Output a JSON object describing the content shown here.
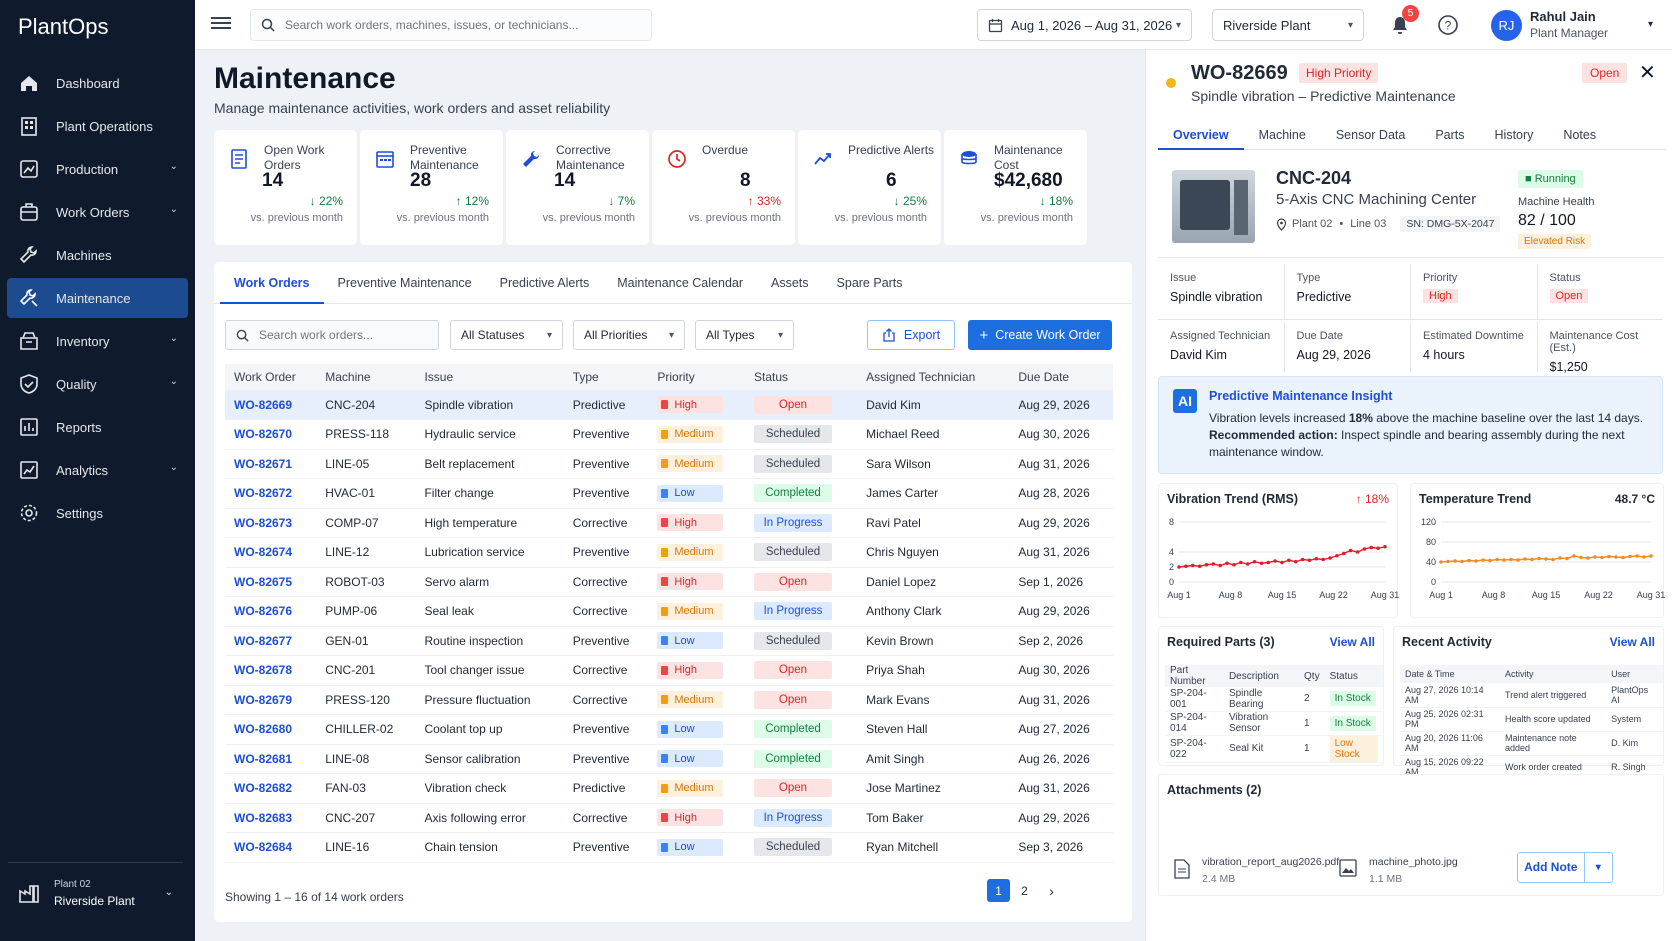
{
  "app": {
    "name": "PlantOps"
  },
  "sidebar": {
    "items": [
      {
        "label": "Dashboard",
        "icon": "home-icon",
        "chev": false
      },
      {
        "label": "Plant Operations",
        "icon": "building-icon",
        "chev": false
      },
      {
        "label": "Production",
        "icon": "production-icon",
        "chev": true
      },
      {
        "label": "Work Orders",
        "icon": "work-orders-icon",
        "chev": true
      },
      {
        "label": "Machines",
        "icon": "wrench-icon",
        "chev": false
      },
      {
        "label": "Maintenance",
        "icon": "maintenance-icon",
        "chev": false,
        "active": true
      },
      {
        "label": "Inventory",
        "icon": "inventory-icon",
        "chev": true
      },
      {
        "label": "Quality",
        "icon": "shield-icon",
        "chev": true
      },
      {
        "label": "Reports",
        "icon": "reports-icon",
        "chev": false
      },
      {
        "label": "Analytics",
        "icon": "analytics-icon",
        "chev": true
      },
      {
        "label": "Settings",
        "icon": "gear-icon",
        "chev": false
      }
    ],
    "footer": {
      "line1": "Plant 02",
      "line2": "Riverside Plant"
    }
  },
  "topbar": {
    "search_placeholder": "Search work orders, machines, issues, or technicians...",
    "date_range": "Aug 1, 2026 – Aug 31, 2026",
    "plant": "Riverside Plant",
    "notifications": "5",
    "user": {
      "initials": "RJ",
      "name": "Rahul Jain",
      "role": "Plant Manager"
    }
  },
  "page": {
    "title": "Maintenance",
    "subtitle": "Manage maintenance activities, work orders and asset reliability"
  },
  "kpis": [
    {
      "label": "Open Work Orders",
      "value": "14",
      "delta": "↓ 22%",
      "dir": "down",
      "compare": "vs. previous month"
    },
    {
      "label": "Preventive Maintenance",
      "value": "28",
      "delta": "↑ 12%",
      "dir": "down",
      "compare": "vs. previous month"
    },
    {
      "label": "Corrective Maintenance",
      "value": "14",
      "delta": "↓ 7%",
      "dir": "down",
      "compare": "vs. previous month"
    },
    {
      "label": "Overdue",
      "value": "8",
      "delta": "↑ 33%",
      "dir": "up",
      "compare": "vs. previous month"
    },
    {
      "label": "Predictive Alerts",
      "value": "6",
      "delta": "↓ 25%",
      "dir": "down",
      "compare": "vs. previous month"
    },
    {
      "label": "Maintenance Cost",
      "value": "$42,680",
      "delta": "↓ 18%",
      "dir": "down",
      "compare": "vs. previous month"
    }
  ],
  "tabs": [
    "Work Orders",
    "Preventive Maintenance",
    "Predictive Alerts",
    "Maintenance Calendar",
    "Assets",
    "Spare Parts"
  ],
  "filters": {
    "search_placeholder": "Search work orders...",
    "status": "All Statuses",
    "priority": "All Priorities",
    "type": "All Types",
    "export": "Export",
    "create": "Create Work Order"
  },
  "table": {
    "headers": [
      "Work Order",
      "Machine",
      "Issue",
      "Type",
      "Priority",
      "Status",
      "Assigned Technician",
      "Due Date"
    ],
    "rows": [
      [
        "WO-82669",
        "CNC-204",
        "Spindle vibration",
        "Predictive",
        "High",
        "Open",
        "David Kim",
        "Aug 29, 2026"
      ],
      [
        "WO-82670",
        "PRESS-118",
        "Hydraulic service",
        "Preventive",
        "Medium",
        "Scheduled",
        "Michael Reed",
        "Aug 30, 2026"
      ],
      [
        "WO-82671",
        "LINE-05",
        "Belt replacement",
        "Preventive",
        "Medium",
        "Scheduled",
        "Sara Wilson",
        "Aug 31, 2026"
      ],
      [
        "WO-82672",
        "HVAC-01",
        "Filter change",
        "Preventive",
        "Low",
        "Completed",
        "James Carter",
        "Aug 28, 2026"
      ],
      [
        "WO-82673",
        "COMP-07",
        "High temperature",
        "Corrective",
        "High",
        "In Progress",
        "Ravi Patel",
        "Aug 29, 2026"
      ],
      [
        "WO-82674",
        "LINE-12",
        "Lubrication service",
        "Preventive",
        "Medium",
        "Scheduled",
        "Chris Nguyen",
        "Aug 31, 2026"
      ],
      [
        "WO-82675",
        "ROBOT-03",
        "Servo alarm",
        "Corrective",
        "High",
        "Open",
        "Daniel Lopez",
        "Sep 1, 2026"
      ],
      [
        "WO-82676",
        "PUMP-06",
        "Seal leak",
        "Corrective",
        "Medium",
        "In Progress",
        "Anthony Clark",
        "Aug 29, 2026"
      ],
      [
        "WO-82677",
        "GEN-01",
        "Routine inspection",
        "Preventive",
        "Low",
        "Scheduled",
        "Kevin Brown",
        "Sep 2, 2026"
      ],
      [
        "WO-82678",
        "CNC-201",
        "Tool changer issue",
        "Corrective",
        "High",
        "Open",
        "Priya Shah",
        "Aug 30, 2026"
      ],
      [
        "WO-82679",
        "PRESS-120",
        "Pressure fluctuation",
        "Corrective",
        "Medium",
        "Open",
        "Mark Evans",
        "Aug 31, 2026"
      ],
      [
        "WO-82680",
        "CHILLER-02",
        "Coolant top up",
        "Preventive",
        "Low",
        "Completed",
        "Steven Hall",
        "Aug 27, 2026"
      ],
      [
        "WO-82681",
        "LINE-08",
        "Sensor calibration",
        "Preventive",
        "Low",
        "Completed",
        "Amit Singh",
        "Aug 26, 2026"
      ],
      [
        "WO-82682",
        "FAN-03",
        "Vibration check",
        "Predictive",
        "Medium",
        "Open",
        "Jose Martinez",
        "Aug 31, 2026"
      ],
      [
        "WO-82683",
        "CNC-207",
        "Axis following error",
        "Corrective",
        "High",
        "In Progress",
        "Tom Baker",
        "Aug 29, 2026"
      ],
      [
        "WO-82684",
        "LINE-16",
        "Chain tension",
        "Preventive",
        "Low",
        "Scheduled",
        "Ryan Mitchell",
        "Sep 3, 2026"
      ]
    ],
    "footer": "Showing 1 – 16 of 14 work orders",
    "pages": [
      "1",
      "2"
    ]
  },
  "detail": {
    "id": "WO-82669",
    "priority": "High Priority",
    "status": "Open",
    "subtitle": "Spindle vibration – Predictive Maintenance",
    "tabs": [
      "Overview",
      "Machine",
      "Sensor Data",
      "Parts",
      "History",
      "Notes"
    ],
    "machine": {
      "name": "CNC-204",
      "desc": "5-Axis CNC Machining Center",
      "plant": "Plant 02",
      "line": "Line 03",
      "sn": "SN: DMG-5X-2047",
      "state": "Running",
      "health_label": "Machine Health",
      "health": "82 / 100",
      "risk": "Elevated Risk"
    },
    "info1": [
      {
        "label": "Issue",
        "value": "Spindle vibration"
      },
      {
        "label": "Type",
        "value": "Predictive"
      },
      {
        "label": "Priority",
        "badge": "High"
      },
      {
        "label": "Status",
        "badge": "Open"
      }
    ],
    "info2": [
      {
        "label": "Assigned Technician",
        "value": "David Kim"
      },
      {
        "label": "Due Date",
        "value": "Aug 29, 2026"
      },
      {
        "label": "Estimated Downtime",
        "value": "4 hours"
      },
      {
        "label": "Maintenance Cost (Est.)",
        "value": "$1,250"
      }
    ],
    "insight": {
      "title": "Predictive Maintenance Insight",
      "line1_a": "Vibration levels increased ",
      "line1_b": "18%",
      "line1_c": " above the machine baseline over the last 14 days.",
      "rec_label": "Recommended action:",
      "rec_text": " Inspect spindle and bearing assembly during the next maintenance window."
    },
    "vib": {
      "title": "Vibration Trend (RMS)",
      "delta": "↑ 18%"
    },
    "temp": {
      "title": "Temperature Trend",
      "value": "48.7 °C"
    },
    "parts": {
      "title": "Required Parts (3)",
      "view_all": "View All",
      "headers": [
        "Part Number",
        "Description",
        "Qty",
        "Status"
      ],
      "rows": [
        [
          "SP-204-001",
          "Spindle Bearing",
          "2",
          "In Stock"
        ],
        [
          "SP-204-014",
          "Vibration Sensor",
          "1",
          "In Stock"
        ],
        [
          "SP-204-022",
          "Seal Kit",
          "1",
          "Low Stock"
        ]
      ]
    },
    "activity": {
      "title": "Recent Activity",
      "view_all": "View All",
      "headers": [
        "Date & Time",
        "Activity",
        "User"
      ],
      "rows": [
        [
          "Aug 27, 2026 10:14 AM",
          "Trend alert triggered",
          "PlantOps AI"
        ],
        [
          "Aug 25, 2026 02:31 PM",
          "Health score updated",
          "System"
        ],
        [
          "Aug 20, 2026 11:06 AM",
          "Maintenance note added",
          "D. Kim"
        ],
        [
          "Aug 15, 2026 09:22 AM",
          "Work order created",
          "R. Singh"
        ]
      ]
    },
    "attachments": {
      "title": "Attachments (2)",
      "files": [
        {
          "name": "vibration_report_aug2026.pdf",
          "size": "2.4 MB"
        },
        {
          "name": "machine_photo.jpg",
          "size": "1.1 MB"
        }
      ],
      "add_note": "Add Note"
    }
  },
  "chart_data": [
    {
      "type": "line",
      "title": "Vibration Trend (RMS)",
      "x": [
        "Aug 1",
        "Aug 8",
        "Aug 15",
        "Aug 22",
        "Aug 31"
      ],
      "yticks": [
        "0",
        "2",
        "4",
        "8"
      ],
      "ylim": [
        0,
        8
      ],
      "series": [
        {
          "color": "#e11d2a",
          "values": [
            2.0,
            2.1,
            2.2,
            2.1,
            2.3,
            2.4,
            2.2,
            2.5,
            2.3,
            2.6,
            2.4,
            2.7,
            2.5,
            2.6,
            2.8,
            2.6,
            2.9,
            2.7,
            3.0,
            2.9,
            3.1,
            3.0,
            3.2,
            3.5,
            3.8,
            4.2,
            4.0,
            4.4,
            4.6,
            4.5,
            4.7
          ]
        }
      ]
    },
    {
      "type": "line",
      "title": "Temperature Trend",
      "x": [
        "Aug 1",
        "Aug 8",
        "Aug 15",
        "Aug 22",
        "Aug 31"
      ],
      "yticks": [
        "0",
        "40",
        "80",
        "120"
      ],
      "ylim": [
        0,
        120
      ],
      "series": [
        {
          "color": "#f08c24",
          "values": [
            40,
            41,
            42,
            41,
            43,
            42,
            44,
            43,
            45,
            44,
            45,
            44,
            46,
            45,
            47,
            46,
            45,
            48,
            47,
            52,
            49,
            48,
            50,
            49,
            51,
            50,
            49,
            51,
            52,
            50,
            52
          ]
        }
      ]
    }
  ]
}
